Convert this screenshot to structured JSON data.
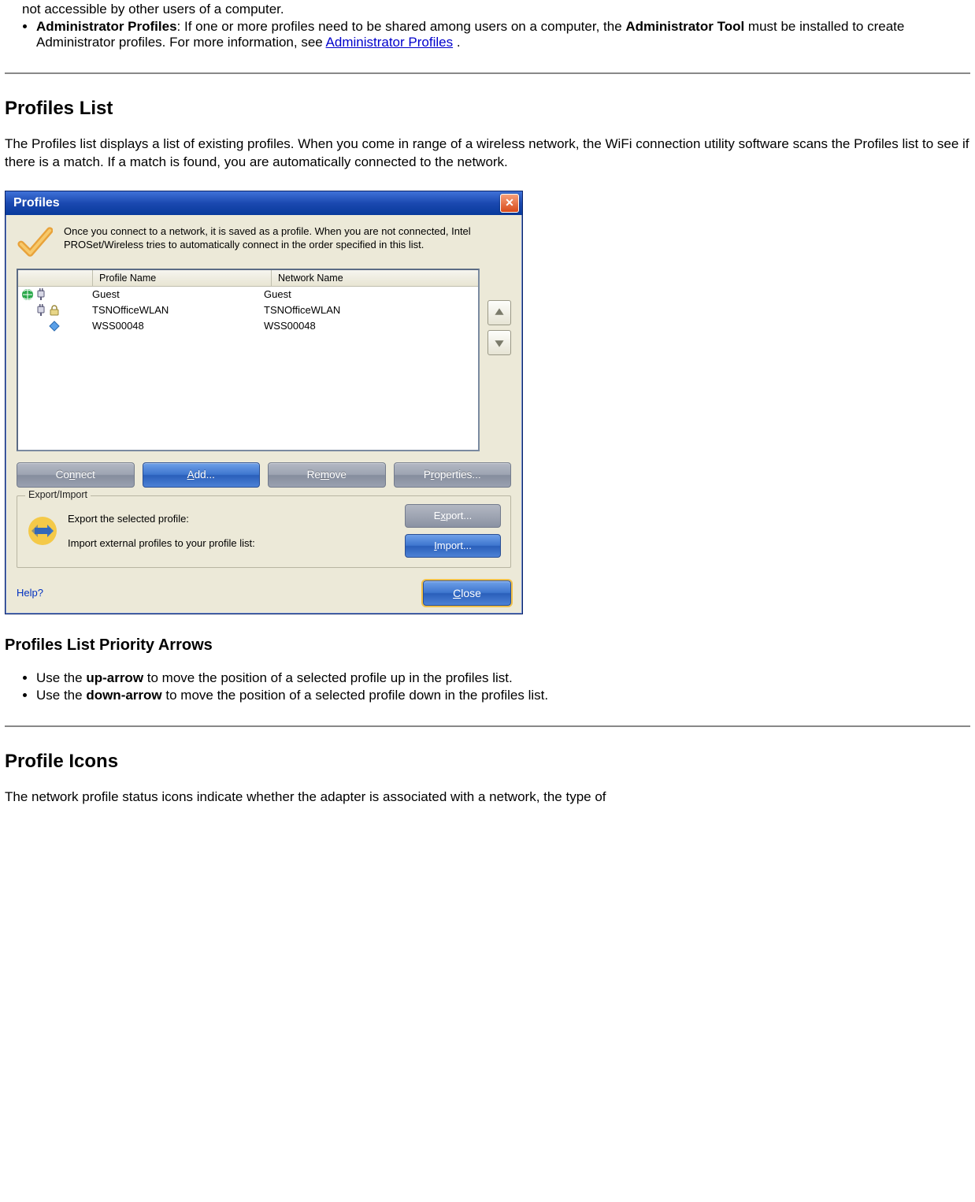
{
  "intro_bullets": {
    "item0": {
      "trail": "not accessible by other users of a computer."
    },
    "item1": {
      "bold": "Administrator Profiles",
      "text1": ": If one or more profiles need to be shared among users on a computer, the ",
      "bold2": "Administrator Tool",
      "text2": " must be installed to create Administrator profiles. For more information, see ",
      "link": "Administrator Profiles",
      "text3": " ."
    }
  },
  "sections": {
    "profiles_list_heading": "Profiles List",
    "profiles_list_para": "The Profiles list displays a list of existing profiles. When you come in range of a wireless network, the WiFi connection utility software scans the Profiles list to see if there is a match. If a match is found, you are automatically connected to the network.",
    "priority_heading": "Profiles List Priority Arrows",
    "priority_items": {
      "i0_pre": "Use the ",
      "i0_bold": "up-arrow",
      "i0_post": " to move the position of a selected profile up in the profiles list.",
      "i1_pre": "Use the ",
      "i1_bold": "down-arrow",
      "i1_post": " to move the position of a selected profile down in the profiles list."
    },
    "icons_heading": "Profile Icons",
    "icons_para": "The network profile status icons indicate whether the adapter is associated with a network, the type of"
  },
  "window": {
    "title": "Profiles",
    "intro": "Once you connect to a network, it is saved as a profile. When you are not connected, Intel PROSet/Wireless tries to automatically connect in the order specified in this list.",
    "columns": {
      "c1_blank": "",
      "profile": "Profile Name",
      "network": "Network Name"
    },
    "rows": [
      {
        "profile": "Guest",
        "network": "Guest"
      },
      {
        "profile": "TSNOfficeWLAN",
        "network": "TSNOfficeWLAN"
      },
      {
        "profile": "WSS00048",
        "network": "WSS00048"
      }
    ],
    "buttons": {
      "connect_pre": "Co",
      "connect_u": "n",
      "connect_post": "nect",
      "add_u": "A",
      "add_post": "dd...",
      "remove_pre": "Re",
      "remove_u": "m",
      "remove_post": "ove",
      "props_pre": "P",
      "props_u": "r",
      "props_post": "operties..."
    },
    "exportimport": {
      "legend": "Export/Import",
      "export_label": "Export the selected profile:",
      "import_label": "Import external profiles to your profile list:",
      "export_btn_pre": "E",
      "export_btn_u": "x",
      "export_btn_post": "port...",
      "import_btn_u": "I",
      "import_btn_post": "mport..."
    },
    "help": "Help?",
    "close_u": "C",
    "close_post": "lose"
  }
}
